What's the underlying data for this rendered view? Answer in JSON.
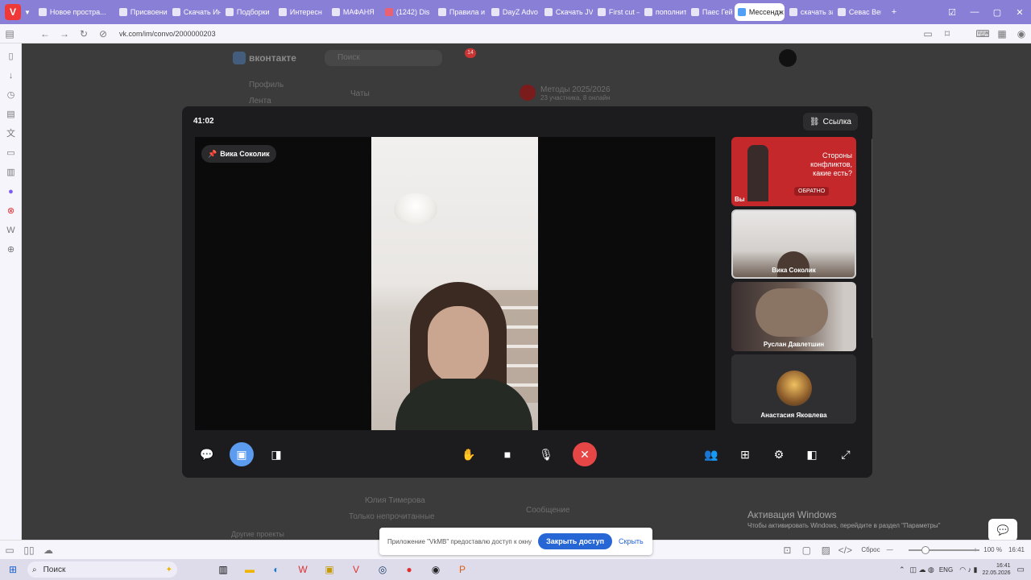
{
  "browser": {
    "tabs": [
      {
        "label": "Новое простра..."
      },
      {
        "label": "Присвоение"
      },
      {
        "label": "Скачать Ин"
      },
      {
        "label": "Подборки"
      },
      {
        "label": "Интересн"
      },
      {
        "label": "МАФАНЯ"
      },
      {
        "label": "(1242) Dis"
      },
      {
        "label": "Правила и"
      },
      {
        "label": "DayZ Advo"
      },
      {
        "label": "Скачать JV"
      },
      {
        "label": "First cut —"
      },
      {
        "label": "пополнит"
      },
      {
        "label": "Паес Гейм"
      },
      {
        "label": "Мессендж",
        "active": true
      },
      {
        "label": "скачать за"
      },
      {
        "label": "Севас Вег"
      }
    ],
    "url": "vk.com/im/convo/2000000203"
  },
  "vk": {
    "brand": "вконтакте",
    "search_placeholder": "Поиск",
    "notif_count": "14",
    "nav_profile": "Профиль",
    "nav_feed": "Лента",
    "chats_label": "Чаты",
    "convo_title": "Методы 2025/2026",
    "convo_sub": "23 участника, 8 онлайн",
    "chat_name": "Юлия Тимерова",
    "only_unread": "Только непрочитанные",
    "message_placeholder": "Сообщение",
    "other_projects": "Другие проекты"
  },
  "call": {
    "timer": "41:02",
    "link_label": "Ссылка",
    "pinned_name": "Вика Соколик",
    "participants": [
      {
        "name": "Вы",
        "banner_text": "Стороны конфликтов, какие есть?",
        "banner_badge": "ОБРАТНО"
      },
      {
        "name": "Вика Соколик"
      },
      {
        "name": "Руслан Давлетшин"
      },
      {
        "name": "Анастасия Яковлева"
      }
    ]
  },
  "access_banner": {
    "text": "Приложение \"VkMB\" предоставлю доступ к окну",
    "close_label": "Закрыть доступ",
    "hide_label": "Скрыть"
  },
  "windows": {
    "activate_title": "Активация Windows",
    "activate_sub": "Чтобы активировать Windows, перейдите в раздел \"Параметры\"",
    "search_label": "Поиск",
    "zoom_reset": "Сброс",
    "zoom": "100 %",
    "time_status": "16:41",
    "lang": "ENG",
    "clock_time": "16:41",
    "clock_date": "22.05.2026"
  },
  "colors": {
    "accent": "#2787f5",
    "end_call": "#e64646",
    "tabbar": "#8a7fd6"
  }
}
